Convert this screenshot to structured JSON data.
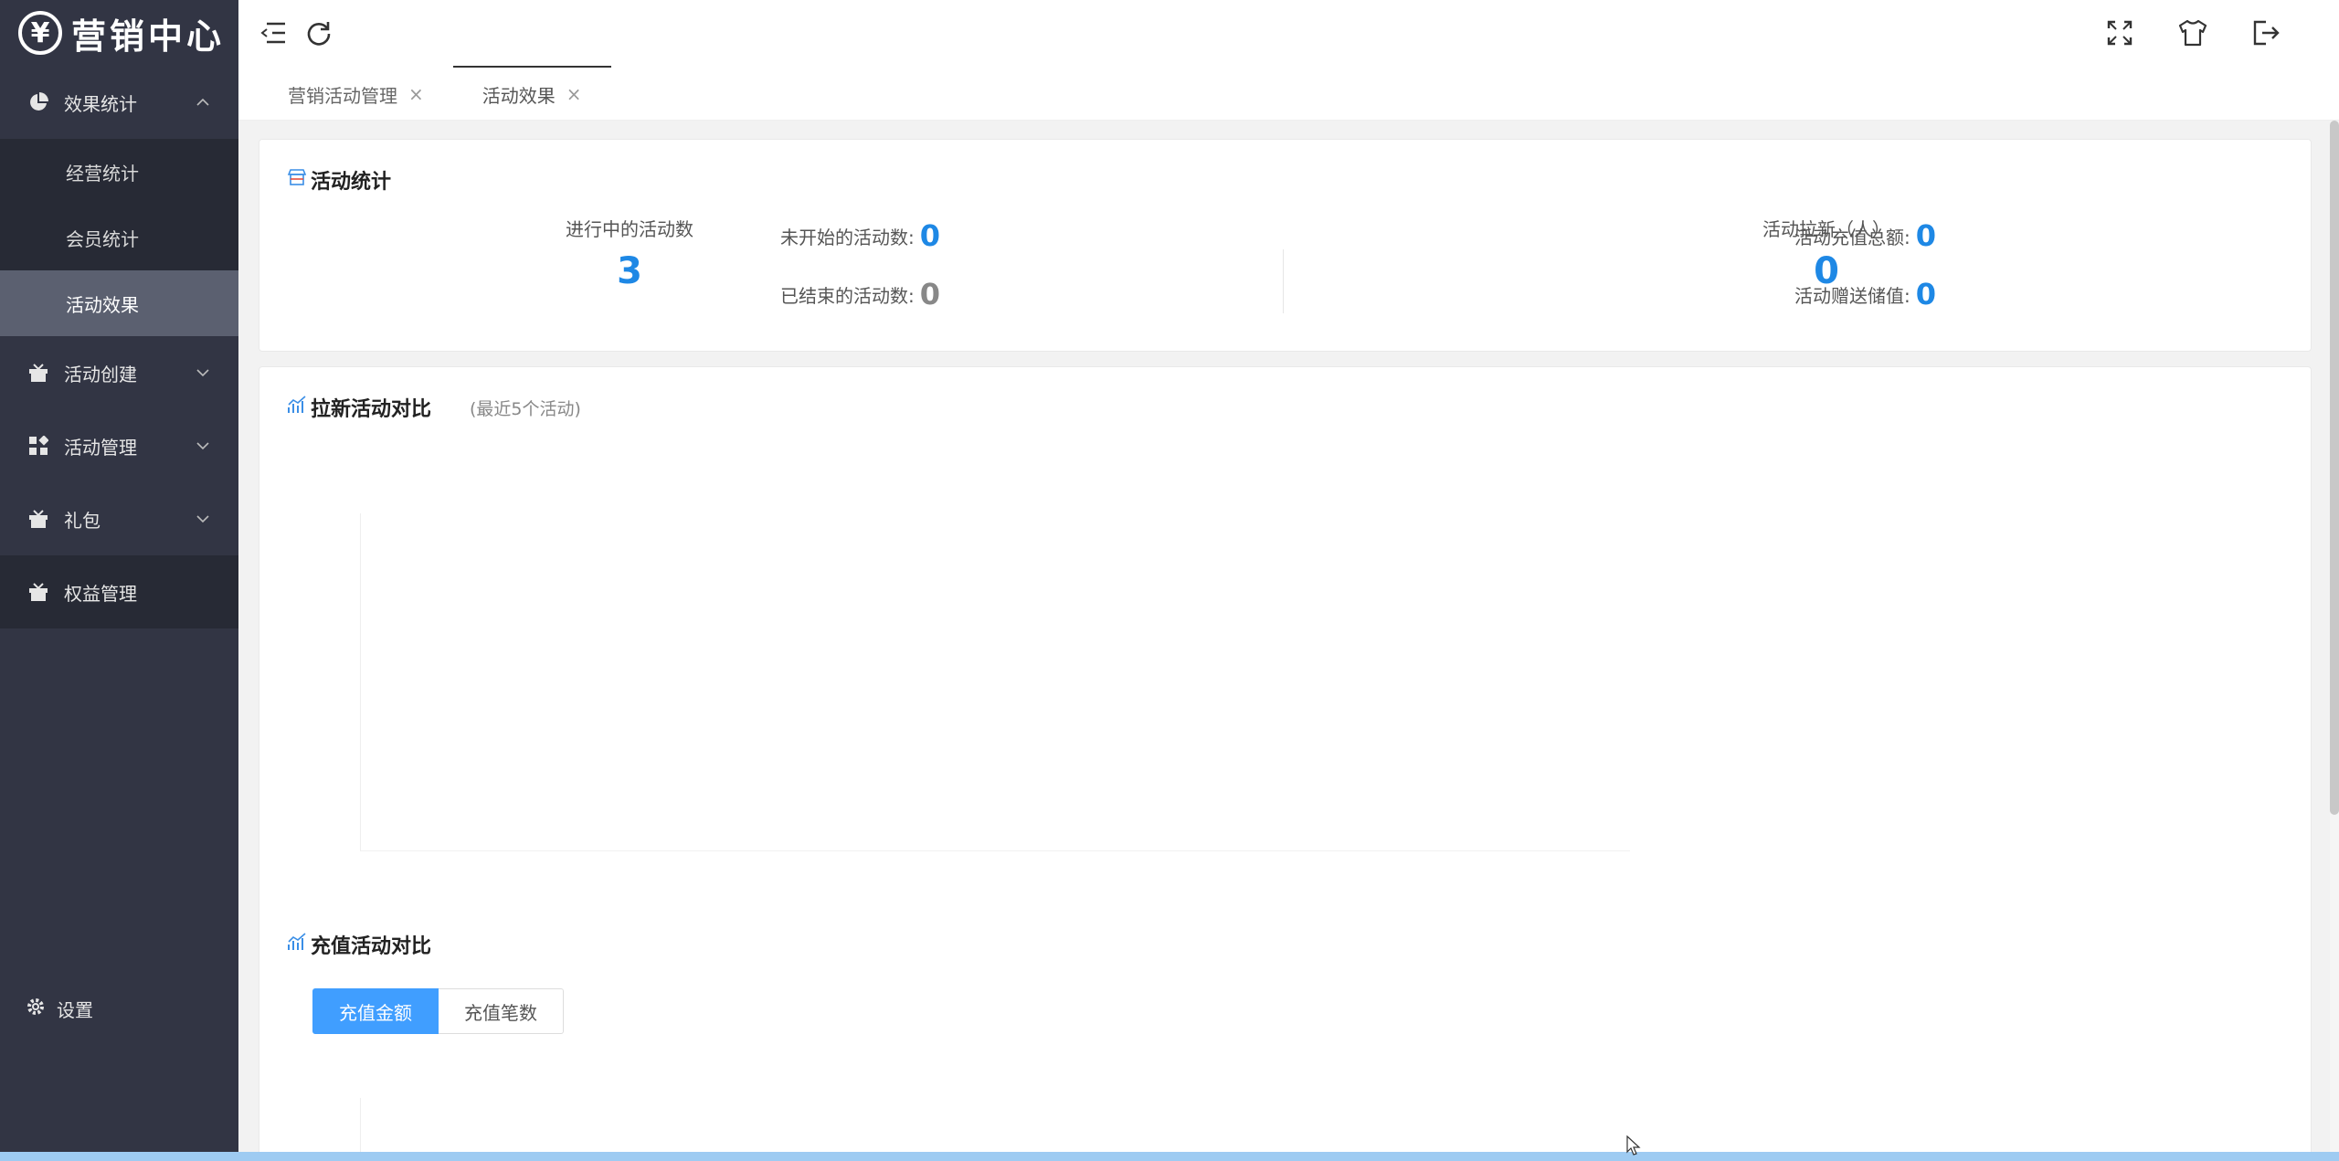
{
  "brand": {
    "logo_symbol": "¥",
    "title": "营销中心"
  },
  "sidebar": {
    "groups": [
      {
        "label": "效果统计",
        "icon": "pie-chart-icon",
        "expanded": true,
        "items": [
          {
            "label": "经营统计"
          },
          {
            "label": "会员统计"
          },
          {
            "label": "活动效果",
            "active": true
          }
        ]
      },
      {
        "label": "活动创建",
        "icon": "gift-icon"
      },
      {
        "label": "活动管理",
        "icon": "grid-icon"
      },
      {
        "label": "礼包",
        "icon": "gift-icon"
      },
      {
        "label": "权益管理",
        "icon": "gift-icon"
      }
    ],
    "settings_label": "设置"
  },
  "topbar": {
    "left_icons": [
      "menu-fold-icon",
      "refresh-icon"
    ],
    "right_icons": [
      "fullscreen-icon",
      "theme-shirt-icon",
      "logout-icon"
    ]
  },
  "tabs": [
    {
      "label": "营销活动管理",
      "close": "×",
      "active": false
    },
    {
      "label": "活动效果",
      "close": "×",
      "active": true
    }
  ],
  "stats": {
    "title": "活动统计",
    "ongoing": {
      "label": "进行中的活动数",
      "value": "3"
    },
    "not_started": {
      "label": "未开始的活动数:",
      "value": "0"
    },
    "ended": {
      "label": "已结束的活动数:",
      "value": "0"
    },
    "new_members": {
      "label": "活动拉新（人）",
      "value": "0"
    },
    "recharge_total": {
      "label": "活动充值总额:",
      "value": "0"
    },
    "gift_value": {
      "label": "活动赠送储值:",
      "value": "0"
    }
  },
  "charts": {
    "pull_new": {
      "title": "拉新活动对比",
      "subtitle": "(最近5个活动)"
    },
    "recharge": {
      "title": "充值活动对比",
      "buttons": [
        "充值金额",
        "充值笔数"
      ],
      "selected": "充值金额"
    }
  },
  "colors": {
    "sidebar_bg": "#323544",
    "accent": "#1e88e5",
    "primary_button": "#409eff"
  }
}
